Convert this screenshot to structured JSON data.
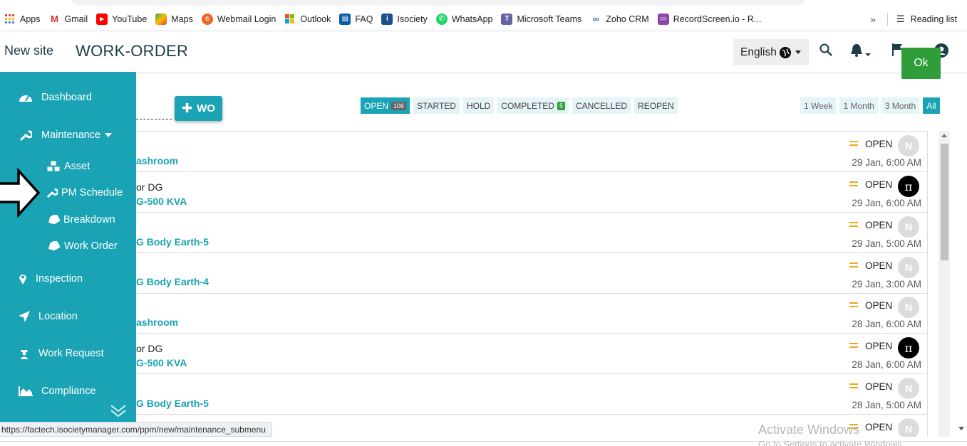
{
  "bookmarks": {
    "items": [
      {
        "label": "Apps",
        "color": "#e8453c"
      },
      {
        "label": "Gmail",
        "color": "#d93025"
      },
      {
        "label": "YouTube",
        "color": "#ff0000"
      },
      {
        "label": "Maps",
        "color": "#34a853"
      },
      {
        "label": "Webmail Login",
        "color": "#f26522"
      },
      {
        "label": "Outlook",
        "color": "#f25022"
      },
      {
        "label": "FAQ",
        "color": "#0a5ca8"
      },
      {
        "label": "Isociety",
        "color": "#1a4f8b"
      },
      {
        "label": "WhatsApp",
        "color": "#25d366"
      },
      {
        "label": "Microsoft Teams",
        "color": "#6264a7"
      },
      {
        "label": "Zoho CRM",
        "color": "#2f6db5"
      },
      {
        "label": "RecordScreen.io - R...",
        "color": "#8e44ad"
      }
    ],
    "more": "»",
    "reading_list": "Reading list"
  },
  "header": {
    "site": "New site",
    "title": "WORK-ORDER",
    "language": "English",
    "ok": "Ok"
  },
  "sidebar": {
    "items": [
      {
        "label": "Dashboard"
      },
      {
        "label": "Maintenance"
      },
      {
        "label": "Inspection"
      },
      {
        "label": "Location"
      },
      {
        "label": "Work Request"
      },
      {
        "label": "Compliance"
      }
    ],
    "submenu": [
      {
        "label": "Asset"
      },
      {
        "label": "PM Schedule"
      },
      {
        "label": "Breakdown"
      },
      {
        "label": "Work Order"
      }
    ]
  },
  "toolbar": {
    "wo_label": "WO",
    "status_tabs": [
      {
        "label": "OPEN",
        "count": "106"
      },
      {
        "label": "STARTED"
      },
      {
        "label": "HOLD"
      },
      {
        "label": "COMPLETED",
        "count": "5"
      },
      {
        "label": "CANCELLED"
      },
      {
        "label": "REOPEN"
      }
    ],
    "range_tabs": [
      "1 Week",
      "1 Month",
      "3 Month",
      "All"
    ]
  },
  "work_orders": [
    {
      "sub": "",
      "title": "ashroom",
      "status": "OPEN",
      "avatar": "N",
      "avatar_type": "n",
      "date": "29 Jan, 6:00 AM"
    },
    {
      "sub": "or DG",
      "title": "G-500 KVA",
      "status": "OPEN",
      "avatar": "π",
      "avatar_type": "t",
      "date": "29 Jan, 6:00 AM"
    },
    {
      "sub": "",
      "title": "G Body Earth-5",
      "status": "OPEN",
      "avatar": "N",
      "avatar_type": "n",
      "date": "29 Jan, 5:00 AM"
    },
    {
      "sub": "",
      "title": "G Body Earth-4",
      "status": "OPEN",
      "avatar": "N",
      "avatar_type": "n",
      "date": "29 Jan, 3:00 AM"
    },
    {
      "sub": "",
      "title": "ashroom",
      "status": "OPEN",
      "avatar": "N",
      "avatar_type": "n",
      "date": "28 Jan, 6:00 AM"
    },
    {
      "sub": "or DG",
      "title": "G-500 KVA",
      "status": "OPEN",
      "avatar": "π",
      "avatar_type": "t",
      "date": "28 Jan, 6:00 AM"
    },
    {
      "sub": "",
      "title": "G Body Earth-5",
      "status": "OPEN",
      "avatar": "N",
      "avatar_type": "n",
      "date": "28 Jan, 5:00 AM"
    },
    {
      "sub": "",
      "title": "",
      "status": "OPEN",
      "avatar": "N",
      "avatar_type": "n",
      "date": ""
    }
  ],
  "status_url": "https://factech.isocietymanager.com/ppm/new/maintenance_submenu",
  "watermark": {
    "line1": "Activate Windows",
    "line2": "Go to Settings to activate Windows."
  },
  "colors": {
    "accent": "#1aa3b4",
    "ok": "#2e9d3a",
    "status_equal": "#f0a81a"
  }
}
